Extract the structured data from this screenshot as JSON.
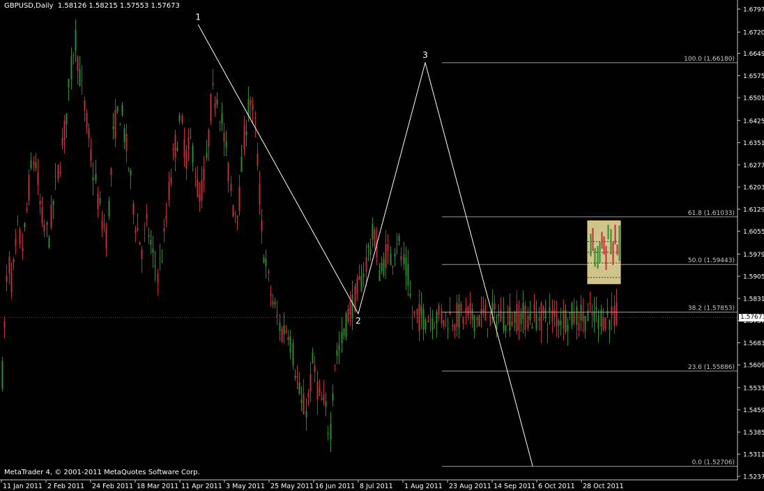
{
  "header": {
    "symbol": "GBPUSD,Daily",
    "ohlc": "1.58126 1.58215 1.57553 1.57673"
  },
  "footer": {
    "copyright": "MetaTrader 4, © 2001-2011 MetaQuotes Software Corp."
  },
  "price_axis": {
    "ticks": [
      "1.67970",
      "1.67200",
      "1.66490",
      "1.65750",
      "1.65010",
      "1.64250",
      "1.63510",
      "1.62770",
      "1.62030",
      "1.61290",
      "1.60550",
      "1.59790",
      "1.59050",
      "1.58310",
      "1.57570",
      "1.56830",
      "1.56090",
      "1.55330",
      "1.54590",
      "1.53850",
      "1.53110",
      "1.52370"
    ],
    "current_price": "1.57673"
  },
  "time_axis": {
    "labels": [
      "11 Jan 2011",
      "2 Feb 2011",
      "24 Feb 2011",
      "18 Mar 2011",
      "11 Apr 2011",
      "3 May 2011",
      "25 May 2011",
      "16 Jun 2011",
      "8 Jul 2011",
      "1 Aug 2011",
      "23 Aug 2011",
      "14 Sep 2011",
      "6 Oct 2011",
      "28 Oct 2011"
    ]
  },
  "zigzag": {
    "points": [
      {
        "label": "1",
        "date": "20 Apr 2011",
        "price": 1.6745
      },
      {
        "label": "2",
        "date": "8 Jul 2011",
        "price": 1.578
      },
      {
        "label": "3",
        "date": "12 Aug 2011",
        "price": 1.6618
      }
    ]
  },
  "fibonacci": {
    "levels": [
      {
        "text": "100.0 (1.66180)",
        "price": 1.6618
      },
      {
        "text": "61.8 (1.61033)",
        "price": 1.61033
      },
      {
        "text": "50.0 (1.59443)",
        "price": 1.59443
      },
      {
        "text": "38.2 (1.57853)",
        "price": 1.57853
      },
      {
        "text": "23.6 (1.55886)",
        "price": 1.55886
      },
      {
        "text": "0.0 (1.52706)",
        "price": 1.52706
      }
    ]
  },
  "highlight_zone": {
    "price_top": 1.609,
    "price_bottom": 1.588,
    "color": "#f5e6a3"
  },
  "colors": {
    "background": "#000000",
    "bull": "#2e8b2e",
    "bear": "#c0303a",
    "lines": "#ffffff",
    "fib": "#9a9a9a"
  }
}
